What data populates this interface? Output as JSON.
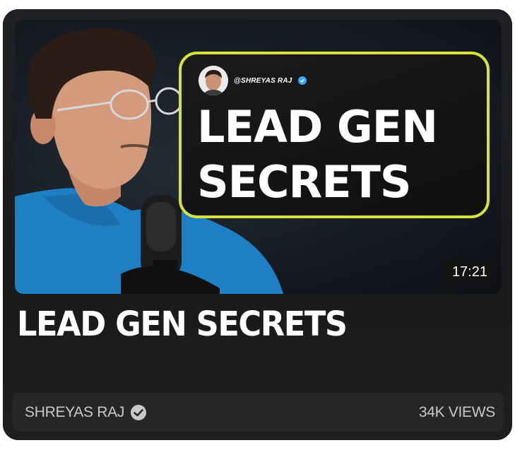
{
  "video": {
    "title": "LEAD GEN SECRETS",
    "duration": "17:21",
    "views": "34K VIEWS",
    "channel_name": "SHREYAS RAJ"
  },
  "thumbnail": {
    "handle": "@SHREYAS RAJ",
    "headline_line1": "LEAD GEN",
    "headline_line2": "SECRETS",
    "accent_color": "#d6e23a",
    "verified_color": "#3ea6ff",
    "shirt_color": "#1f7fc4"
  },
  "icons": {
    "verified_footer": "check-circle-icon",
    "verified_thumb": "verified-badge-icon",
    "microphone": "microphone-icon"
  }
}
